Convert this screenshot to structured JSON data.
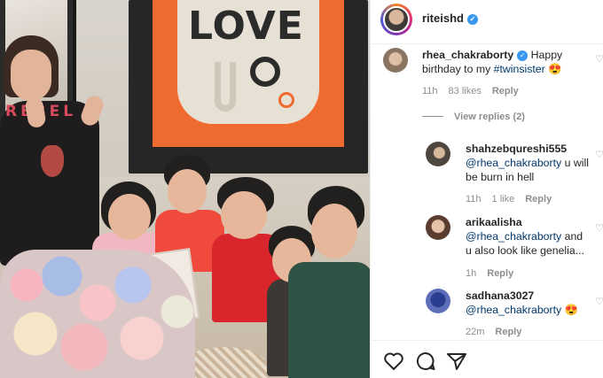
{
  "post": {
    "username": "riteishd",
    "verified": true,
    "poster_text": "LOVE",
    "shirt_text": "REBEL"
  },
  "comments": [
    {
      "username": "rhea_chakraborty",
      "verified": true,
      "text": "Happy birthday to my ",
      "hashtag": "#twinsister",
      "emoji": "😍",
      "time": "11h",
      "likes": "83 likes",
      "reply_label": "Reply"
    },
    {
      "username": "shahzebqureshi555",
      "mention": "@rhea_chakraborty",
      "text": " u will be burn in hell",
      "time": "11h",
      "likes": "1 like",
      "reply_label": "Reply"
    },
    {
      "username": "arikaalisha",
      "mention": "@rhea_chakraborty",
      "text": " and u also look like genelia...",
      "time": "1h",
      "reply_label": "Reply"
    },
    {
      "username": "sadhana3027",
      "mention": "@rhea_chakraborty",
      "emoji": "😍",
      "time": "22m",
      "reply_label": "Reply"
    }
  ],
  "view_replies": "View replies (2)",
  "icons": [
    "like-icon",
    "comment-icon",
    "share-icon"
  ],
  "colors": {
    "link": "#00376b",
    "verified": "#3897f0",
    "meta": "#8e8e8e"
  }
}
